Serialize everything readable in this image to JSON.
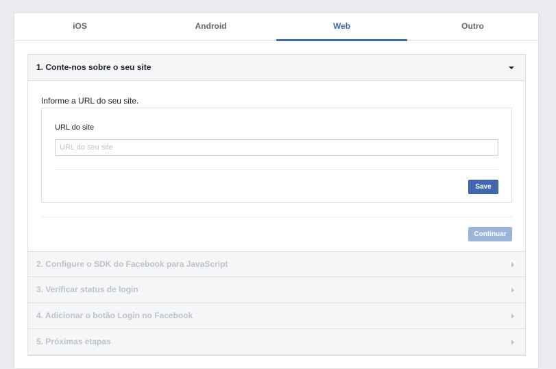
{
  "tabs": [
    {
      "label": "iOS",
      "active": false
    },
    {
      "label": "Android",
      "active": false
    },
    {
      "label": "Web",
      "active": true
    },
    {
      "label": "Outro",
      "active": false
    }
  ],
  "steps": [
    {
      "title": "1. Conte-nos sobre o seu site",
      "state": "open"
    },
    {
      "title": "2. Configure o SDK do Facebook para JavaScript",
      "state": "disabled"
    },
    {
      "title": "3. Verificar status de login",
      "state": "disabled"
    },
    {
      "title": "4. Adicionar o botão Login no Facebook",
      "state": "disabled"
    },
    {
      "title": "5. Próximas etapas",
      "state": "disabled"
    }
  ],
  "step1": {
    "prompt": "Informe a URL do seu site.",
    "field_label": "URL do site",
    "input_value": "",
    "input_placeholder": "URL do seu site",
    "save_label": "Save",
    "continue_label": "Continuar"
  },
  "colors": {
    "accent": "#4267b2",
    "disabled_button": "#9cb4d8",
    "disabled_text": "#bec3c9",
    "background": "#e9ebee"
  }
}
